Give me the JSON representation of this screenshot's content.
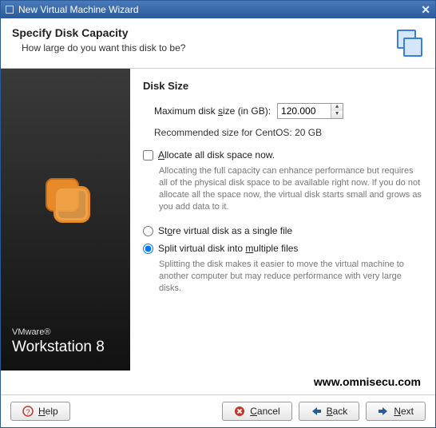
{
  "titlebar": {
    "title": "New Virtual Machine Wizard"
  },
  "header": {
    "title": "Specify Disk Capacity",
    "subtitle": "How large do you want this disk to be?"
  },
  "sidebar": {
    "brand_prefix": "VMware",
    "brand_suffix": "®",
    "product": "Workstation 8"
  },
  "main": {
    "section_title": "Disk Size",
    "max_size_label_pre": "Maximum disk ",
    "max_size_label_u": "s",
    "max_size_label_post": "ize (in GB):",
    "max_size_value": "120.000",
    "recommended": "Recommended size for CentOS: 20 GB",
    "allocate": {
      "checked": false,
      "label_u": "A",
      "label_post": "llocate all disk space now.",
      "desc": "Allocating the full capacity can enhance performance but requires all of the physical disk space to be available right now. If you do not allocate all the space now, the virtual disk starts small and grows as you add data to it."
    },
    "store_mode": "split",
    "single": {
      "label_pre": "St",
      "label_u": "o",
      "label_post": "re virtual disk as a single file"
    },
    "split": {
      "label_pre": "Split virtual disk into ",
      "label_u": "m",
      "label_post": "ultiple files",
      "desc": "Splitting the disk makes it easier to move the virtual machine to another computer but may reduce performance with very large disks."
    }
  },
  "footer": {
    "url": "www.omnisecu.com"
  },
  "buttons": {
    "help_u": "H",
    "help_post": "elp",
    "cancel_u": "C",
    "cancel_post": "ancel",
    "back_u": "B",
    "back_post": "ack",
    "next_u": "N",
    "next_post": "ext"
  }
}
